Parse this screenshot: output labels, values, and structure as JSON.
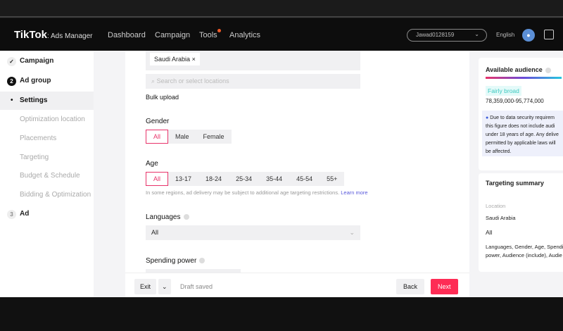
{
  "header": {
    "logo": "TikTok",
    "logo_sub": "Ads Manager",
    "nav": [
      "Dashboard",
      "Campaign",
      "Tools",
      "Analytics"
    ],
    "account": "Jawad0128159",
    "language": "English"
  },
  "sidebar": {
    "campaign": "Campaign",
    "ad_group": "Ad group",
    "ad_group_num": "2",
    "settings": "Settings",
    "items": [
      "Optimization location",
      "Placements",
      "Targeting",
      "Budget & Schedule",
      "Bidding & Optimization"
    ],
    "ad": "Ad",
    "ad_num": "3"
  },
  "form": {
    "location_tag": "Saudi Arabia",
    "search_placeholder": "Search or select locations",
    "bulk_upload": "Bulk upload",
    "gender_label": "Gender",
    "gender_options": [
      "All",
      "Male",
      "Female"
    ],
    "age_label": "Age",
    "age_options": [
      "All",
      "13-17",
      "18-24",
      "25-34",
      "35-44",
      "45-54",
      "55+"
    ],
    "age_note": "In some regions, ad delivery may be subject to additional age targeting restrictions.",
    "learn_more": "Learn more",
    "languages_label": "Languages",
    "languages_value": "All",
    "spending_label": "Spending power"
  },
  "footer": {
    "exit": "Exit",
    "draft": "Draft saved",
    "back": "Back",
    "next": "Next"
  },
  "audience": {
    "title": "Available audience",
    "level": "Fairly broad",
    "range": "78,359,000-95,774,000",
    "info_lines": [
      "Due to data security requirem",
      "this figure does not include audi",
      "under 18 years of age. Any delive",
      "permitted by applicable laws will",
      "be affected."
    ]
  },
  "summary": {
    "title": "Targeting summary",
    "location_label": "Location",
    "location_value": "Saudi Arabia",
    "all": "All",
    "details_lines": [
      "Languages, Gender, Age, Spendin",
      "power, Audience (include), Audie"
    ]
  },
  "colors": {
    "accent": "#fe2c55",
    "link": "#5a5adb"
  }
}
